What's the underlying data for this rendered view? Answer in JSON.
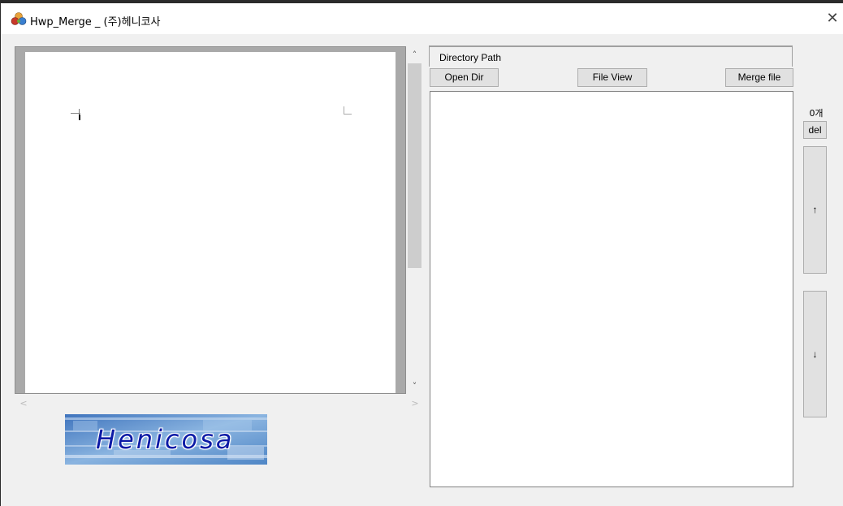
{
  "window": {
    "title": "Hwp_Merge _ (주)헤니코사",
    "close_glyph": "✕"
  },
  "icons": {
    "app": "app-icon",
    "close": "close-icon",
    "scroll_up": "chevron-up-icon",
    "scroll_down": "chevron-down-icon",
    "scroll_left": "chevron-left-icon",
    "scroll_right": "chevron-right-icon"
  },
  "preview": {
    "scroll_up_glyph": "˄",
    "scroll_down_glyph": "˅",
    "scroll_left_glyph": "<",
    "scroll_right_glyph": ">"
  },
  "logo": {
    "text": "Henicosa"
  },
  "files": {
    "directory_label": "Directory Path",
    "open_dir_label": "Open Dir",
    "file_view_label": "File View",
    "merge_file_label": "Merge file",
    "count_label": "0개",
    "items": []
  },
  "side_controls": {
    "del_label": "del",
    "up_label": "↑",
    "down_label": "↓"
  },
  "colors": {
    "window_bg": "#f0f0f0",
    "preview_frame": "#a9a9a9",
    "logo_text": "#0c1aa6",
    "button_bg": "#e1e1e1"
  }
}
